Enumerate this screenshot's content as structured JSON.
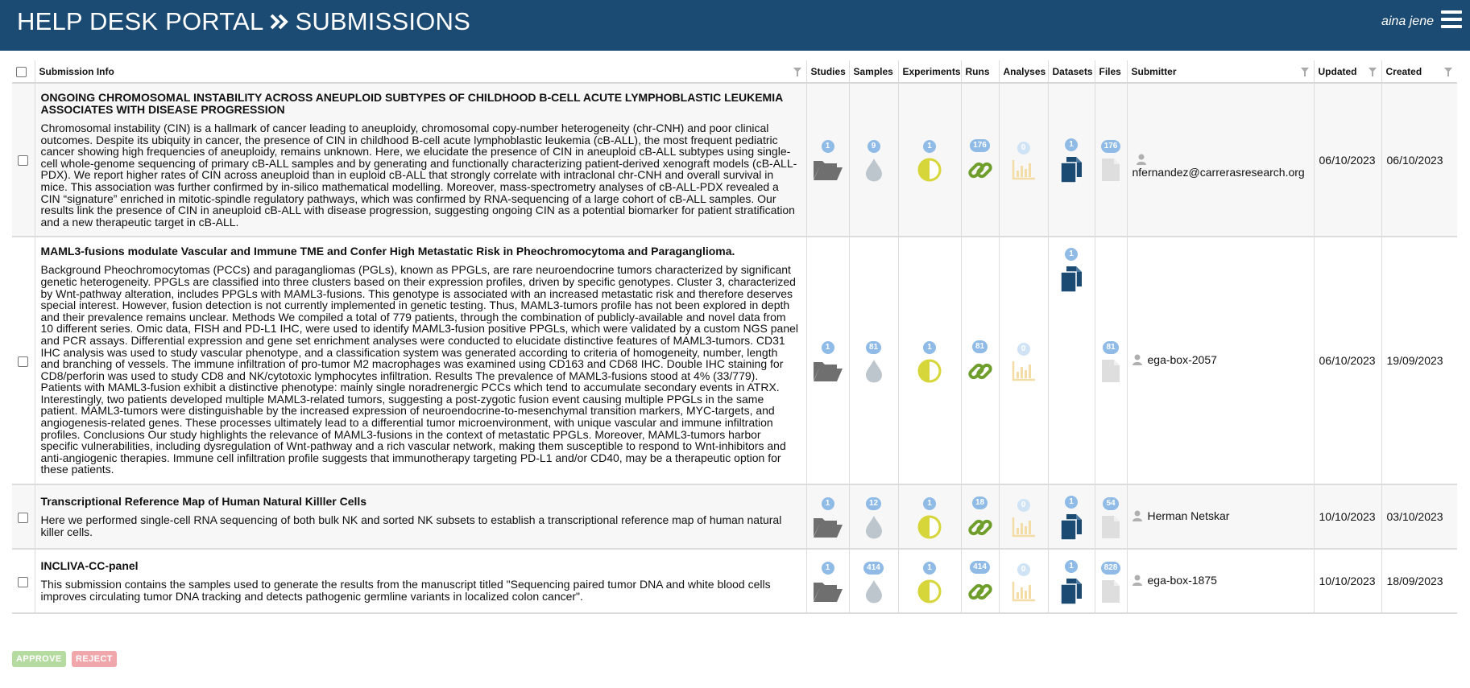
{
  "header": {
    "title": "HELP DESK PORTAL",
    "title_section": "SUBMISSIONS",
    "user": "aina jene"
  },
  "colors": {
    "header_bg": "#1b4a73",
    "badge": "#8fbbe6",
    "badge_faded": "#cfe3f5",
    "folder": "#6f6f6f",
    "drop": "#bcc6cc",
    "experiment": "#d6d63a",
    "run": "#6f9e2c",
    "analysis": "#f4dca6",
    "dataset": "#1b4a73",
    "file": "#dedede",
    "approve": "#b5dba0",
    "reject": "#f0a7ab"
  },
  "columns": {
    "info": "Submission Info",
    "studies": "Studies",
    "samples": "Samples",
    "experiments": "Experiments",
    "runs": "Runs",
    "analyses": "Analyses",
    "datasets": "Datasets",
    "files": "Files",
    "submitter": "Submitter",
    "updated": "Updated",
    "created": "Created"
  },
  "rows": [
    {
      "title": "ONGOING CHROMOSOMAL INSTABILITY ACROSS ANEUPLOID SUBTYPES OF CHILDHOOD B-CELL ACUTE LYMPHOBLASTIC LEUKEMIA ASSOCIATES WITH DISEASE PROGRESSION",
      "description": "Chromosomal instability (CIN) is a hallmark of cancer leading to aneuploidy, chromosomal copy-number heterogeneity (chr-CNH) and poor clinical outcomes. Despite its ubiquity in cancer, the presence of CIN in childhood B-cell acute lymphoblastic leukemia (cB-ALL), the most frequent pediatric cancer showing high frequencies of aneuploidy, remains unknown. Here, we elucidate the presence of CIN in aneuploid cB-ALL subtypes using single-cell whole-genome sequencing of primary cB-ALL samples and by generating and functionally characterizing patient-derived xenograft models (cB-ALL-PDX). We report higher rates of CIN across aneuploid than in euploid cB-ALL that strongly correlate with intraclonal chr-CNH and overall survival in mice. This association was further confirmed by in-silico mathematical modelling. Moreover, mass-spectrometry analyses of cB-ALL-PDX revealed a CIN “signature” enriched in mitotic-spindle regulatory pathways, which was confirmed by RNA-sequencing of a large cohort of cB-ALL samples. Our results link the presence of CIN in aneuploid cB-ALL with disease progression, suggesting ongoing CIN as a potential biomarker for patient stratification and a new therapeutic target in cB-ALL.",
      "studies": "1",
      "samples": "9",
      "experiments": "1",
      "runs": "176",
      "analyses": "0",
      "datasets": "1",
      "files": "176",
      "submitter": "nfernandez@carrerasresearch.org",
      "updated": "06/10/2023",
      "created": "06/10/2023"
    },
    {
      "title": "MAML3-fusions modulate Vascular and Immune TME and Confer High Metastatic Risk in Pheochromocytoma and Paraganglioma.",
      "description": "Background Pheochromocytomas (PCCs) and paragangliomas (PGLs), known as PPGLs, are rare neuroendocrine tumors characterized by significant genetic heterogeneity. PPGLs are classified into three clusters based on their expression profiles, driven by specific genotypes. Cluster 3, characterized by Wnt-pathway alteration, includes PPGLs with MAML3-fusions. This genotype is associated with an increased metastatic risk and therefore deserves special interest. However, fusion detection is not currently implemented in genetic testing. Thus, MAML3-tumors profile has not been explored in depth and their prevalence remains unclear. Methods We compiled a total of 779 patients, through the combination of publicly-available and novel data from 10 different series. Omic data, FISH and PD-L1 IHC, were used to identify MAML3-fusion positive PPGLs, which were validated by a custom NGS panel and PCR assays. Differential expression and gene set enrichment analyses were conducted to elucidate distinctive features of MAML3-tumors. CD31 IHC analysis was used to study vascular phenotype, and a classification system was generated according to criteria of homogeneity, number, length and branching of vessels. The immune infiltration of pro-tumor M2 macrophages was examined using CD163 and CD68 IHC. Double IHC staining for CD8/perforin was used to study CD8 and NK/cytotoxic lymphocytes infiltration. Results The prevalence of MAML3-fusions stood at 4% (33/779). Patients with MAML3-fusion exhibit a distinctive phenotype: mainly single noradrenergic PCCs which tend to accumulate secondary events in ATRX. Interestingly, two patients developed multiple MAML3-related tumors, suggesting a post-zygotic fusion event causing multiple PPGLs in the same patient. MAML3-tumors were distinguishable by the increased expression of neuroendocrine-to-mesenchymal transition markers, MYC-targets, and angiogenesis-related genes. These processes ultimately lead to a differential tumor microenvironment, with unique vascular and immune infiltration profiles. Conclusions Our study highlights the relevance of MAML3-fusions in the context of metastatic PPGLs. Moreover, MAML3-tumors harbor specific vulnerabilities, including dysregulation of Wnt-pathway and a rich vascular network, making them susceptible to respond to Wnt-inhibitors and anti-angiogenic therapies. Immune cell infiltration profile suggests that immunotherapy targeting PD-L1 and/or CD40, may be a therapeutic option for these patients.",
      "studies": "1",
      "samples": "81",
      "experiments": "1",
      "runs": "81",
      "analyses": "0",
      "datasets": "1",
      "files": "81",
      "submitter": "ega-box-2057",
      "updated": "06/10/2023",
      "created": "19/09/2023"
    },
    {
      "title": "Transcriptional Reference Map of Human Natural Killler Cells",
      "description": "Here we performed single-cell RNA sequencing of both bulk NK and sorted NK subsets to establish a transcriptional reference map of human natural killer cells.",
      "studies": "1",
      "samples": "12",
      "experiments": "1",
      "runs": "18",
      "analyses": "0",
      "datasets": "1",
      "files": "54",
      "submitter": "Herman Netskar",
      "updated": "10/10/2023",
      "created": "03/10/2023"
    },
    {
      "title": "INCLIVA-CC-panel",
      "description": "This submission contains the samples used to generate the results from the manuscript titled \"Sequencing paired tumor DNA and white blood cells improves circulating tumor DNA tracking and detects pathogenic germline variants in localized colon cancer\".",
      "studies": "1",
      "samples": "414",
      "experiments": "1",
      "runs": "414",
      "analyses": "0",
      "datasets": "1",
      "files": "828",
      "submitter": "ega-box-1875",
      "updated": "10/10/2023",
      "created": "18/09/2023"
    }
  ],
  "actions": {
    "approve": "APPROVE",
    "reject": "REJECT"
  }
}
